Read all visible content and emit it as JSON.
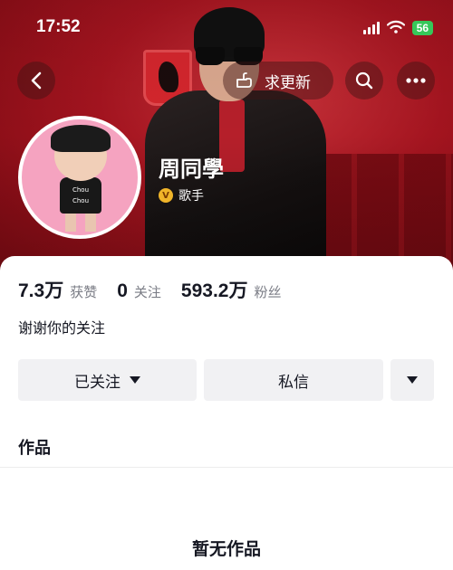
{
  "status_bar": {
    "time": "17:52",
    "battery": "56",
    "icons": [
      "signal-icon",
      "wifi-icon",
      "battery-icon"
    ]
  },
  "nav": {
    "back_icon": "chevron-left-icon",
    "update_label": "求更新",
    "update_icon": "pointing-hand-icon",
    "search_icon": "search-icon",
    "more_icon": "more-dots-icon"
  },
  "profile": {
    "name": "周同學",
    "tag_badge": "V",
    "tag": "歌手",
    "bio": "谢谢你的关注"
  },
  "stats": [
    {
      "value": "7.3万",
      "label": "获赞"
    },
    {
      "value": "0",
      "label": "关注"
    },
    {
      "value": "593.2万",
      "label": "粉丝"
    }
  ],
  "actions": {
    "follow_label": "已关注",
    "message_label": "私信"
  },
  "tabs": {
    "works_label": "作品"
  },
  "empty_state": "暂无作品",
  "avatar": {
    "shirt_print": "Chou Chou"
  },
  "colors": {
    "banner": "#a3141f",
    "text": "#161823",
    "secondary_text": "#7a7c85",
    "button_bg": "#f1f1f3",
    "battery_green": "#36c759",
    "badge_gold": "#f0b429"
  }
}
